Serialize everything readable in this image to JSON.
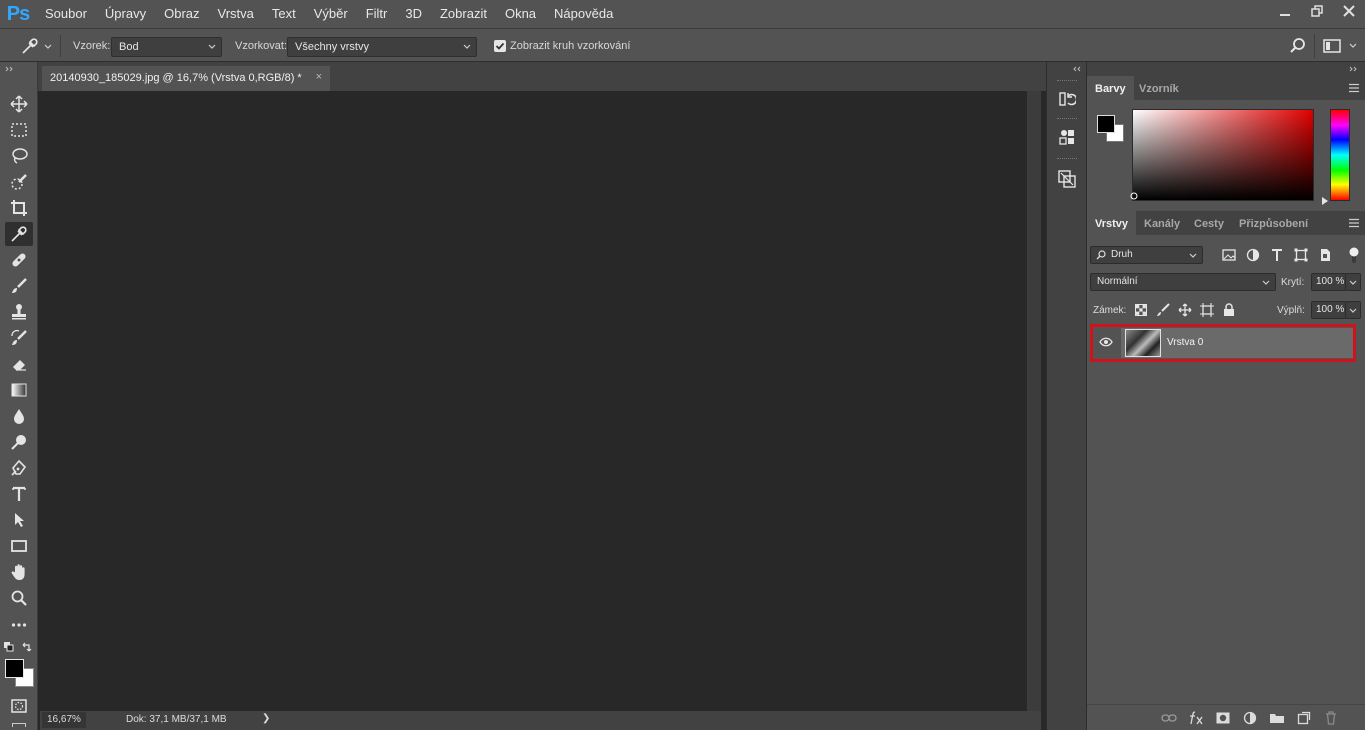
{
  "app": {
    "logo": "Ps"
  },
  "menu": [
    "Soubor",
    "Úpravy",
    "Obraz",
    "Vrstva",
    "Text",
    "Výběr",
    "Filtr",
    "3D",
    "Zobrazit",
    "Okna",
    "Nápověda"
  ],
  "options": {
    "sample_label": "Vzorek:",
    "sample_value": "Bod",
    "sample_layers_label": "Vzorkovat:",
    "sample_layers_value": "Všechny vrstvy",
    "show_ring_label": "Zobrazit kruh vzorkování"
  },
  "document": {
    "tab_title": "20140930_185029.jpg @ 16,7% (Vrstva 0,RGB/8) *",
    "close": "×",
    "zoom": "16,67%",
    "doc_size": "Dok: 37,1 MB/37,1 MB",
    "status_arrow": "❯"
  },
  "color_panel": {
    "tabs": [
      "Barvy",
      "Vzorník"
    ]
  },
  "layers_panel": {
    "tabs": [
      "Vrstvy",
      "Kanály",
      "Cesty",
      "Přizpůsobení"
    ],
    "filter_label": "Druh",
    "blend_mode": "Normální",
    "opacity_label": "Krytí:",
    "opacity_value": "100 %",
    "lock_label": "Zámek:",
    "fill_label": "Výplň:",
    "fill_value": "100 %",
    "layers": [
      {
        "name": "Vrstva 0",
        "visible": true,
        "highlighted": true
      }
    ]
  },
  "colors": {
    "foreground": "#000000",
    "background": "#ffffff",
    "highlight": "#d0121b",
    "accent": "#31a8ff"
  }
}
